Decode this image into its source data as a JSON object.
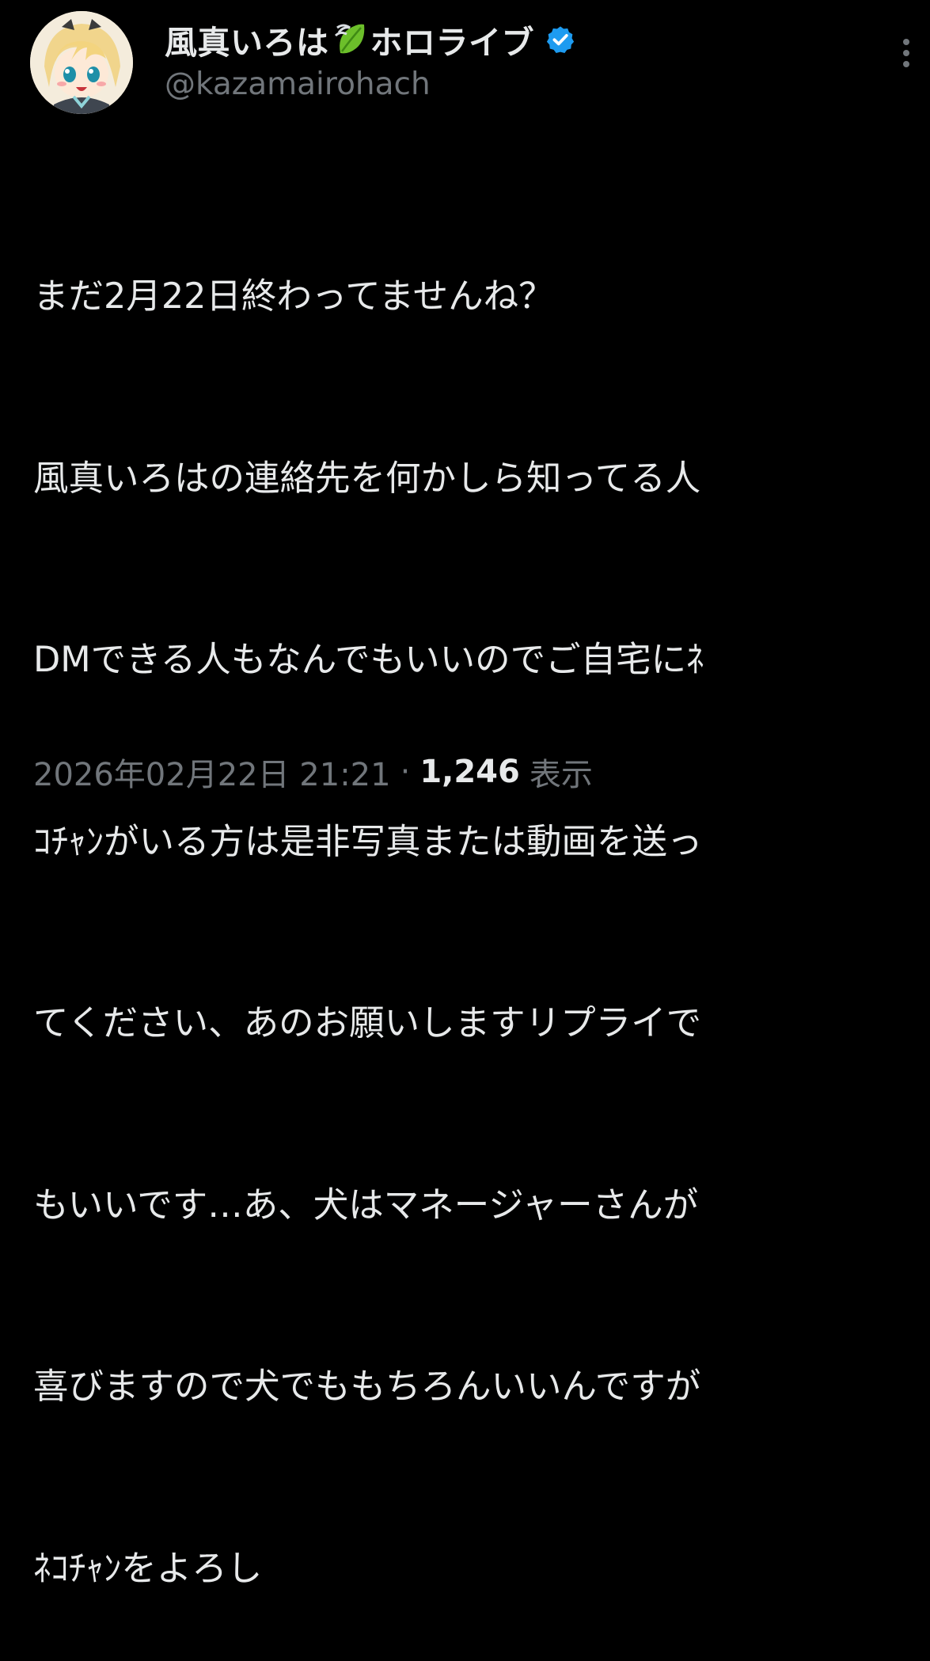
{
  "author": {
    "display_name": "風真いろは",
    "affiliation": "ホロライブ",
    "handle": "@kazamairohach"
  },
  "icons": {
    "avatar": "avatar-icon",
    "leaf": "leaf-emoji-icon",
    "verified": "verified-badge-icon",
    "more": "more-vertical-icon"
  },
  "colors": {
    "background": "#000000",
    "text_primary": "#e7e9ea",
    "text_secondary": "#71767b",
    "verified_blue": "#1d9bf0",
    "leaf_green": "#6cbf2a"
  },
  "tweet": {
    "lines": [
      "まだ2月22日終わってませんね？",
      "風真いろはの連絡先を何かしら知ってる人",
      "DMできる人もなんでもいいのでご自宅にﾈ",
      "ｺﾁｬﾝがいる方は是非写真または動画を送っ",
      "てください、あのお願いしますリプライで",
      "もいいです…あ、犬はマネージャーさんが",
      "喜びますので犬でももちろんいいんですが",
      "ﾈｺﾁｬﾝをよろし"
    ]
  },
  "meta": {
    "timestamp": "2026年02月22日 21:21",
    "separator": "·",
    "views": "1,246",
    "views_label": "表示"
  }
}
